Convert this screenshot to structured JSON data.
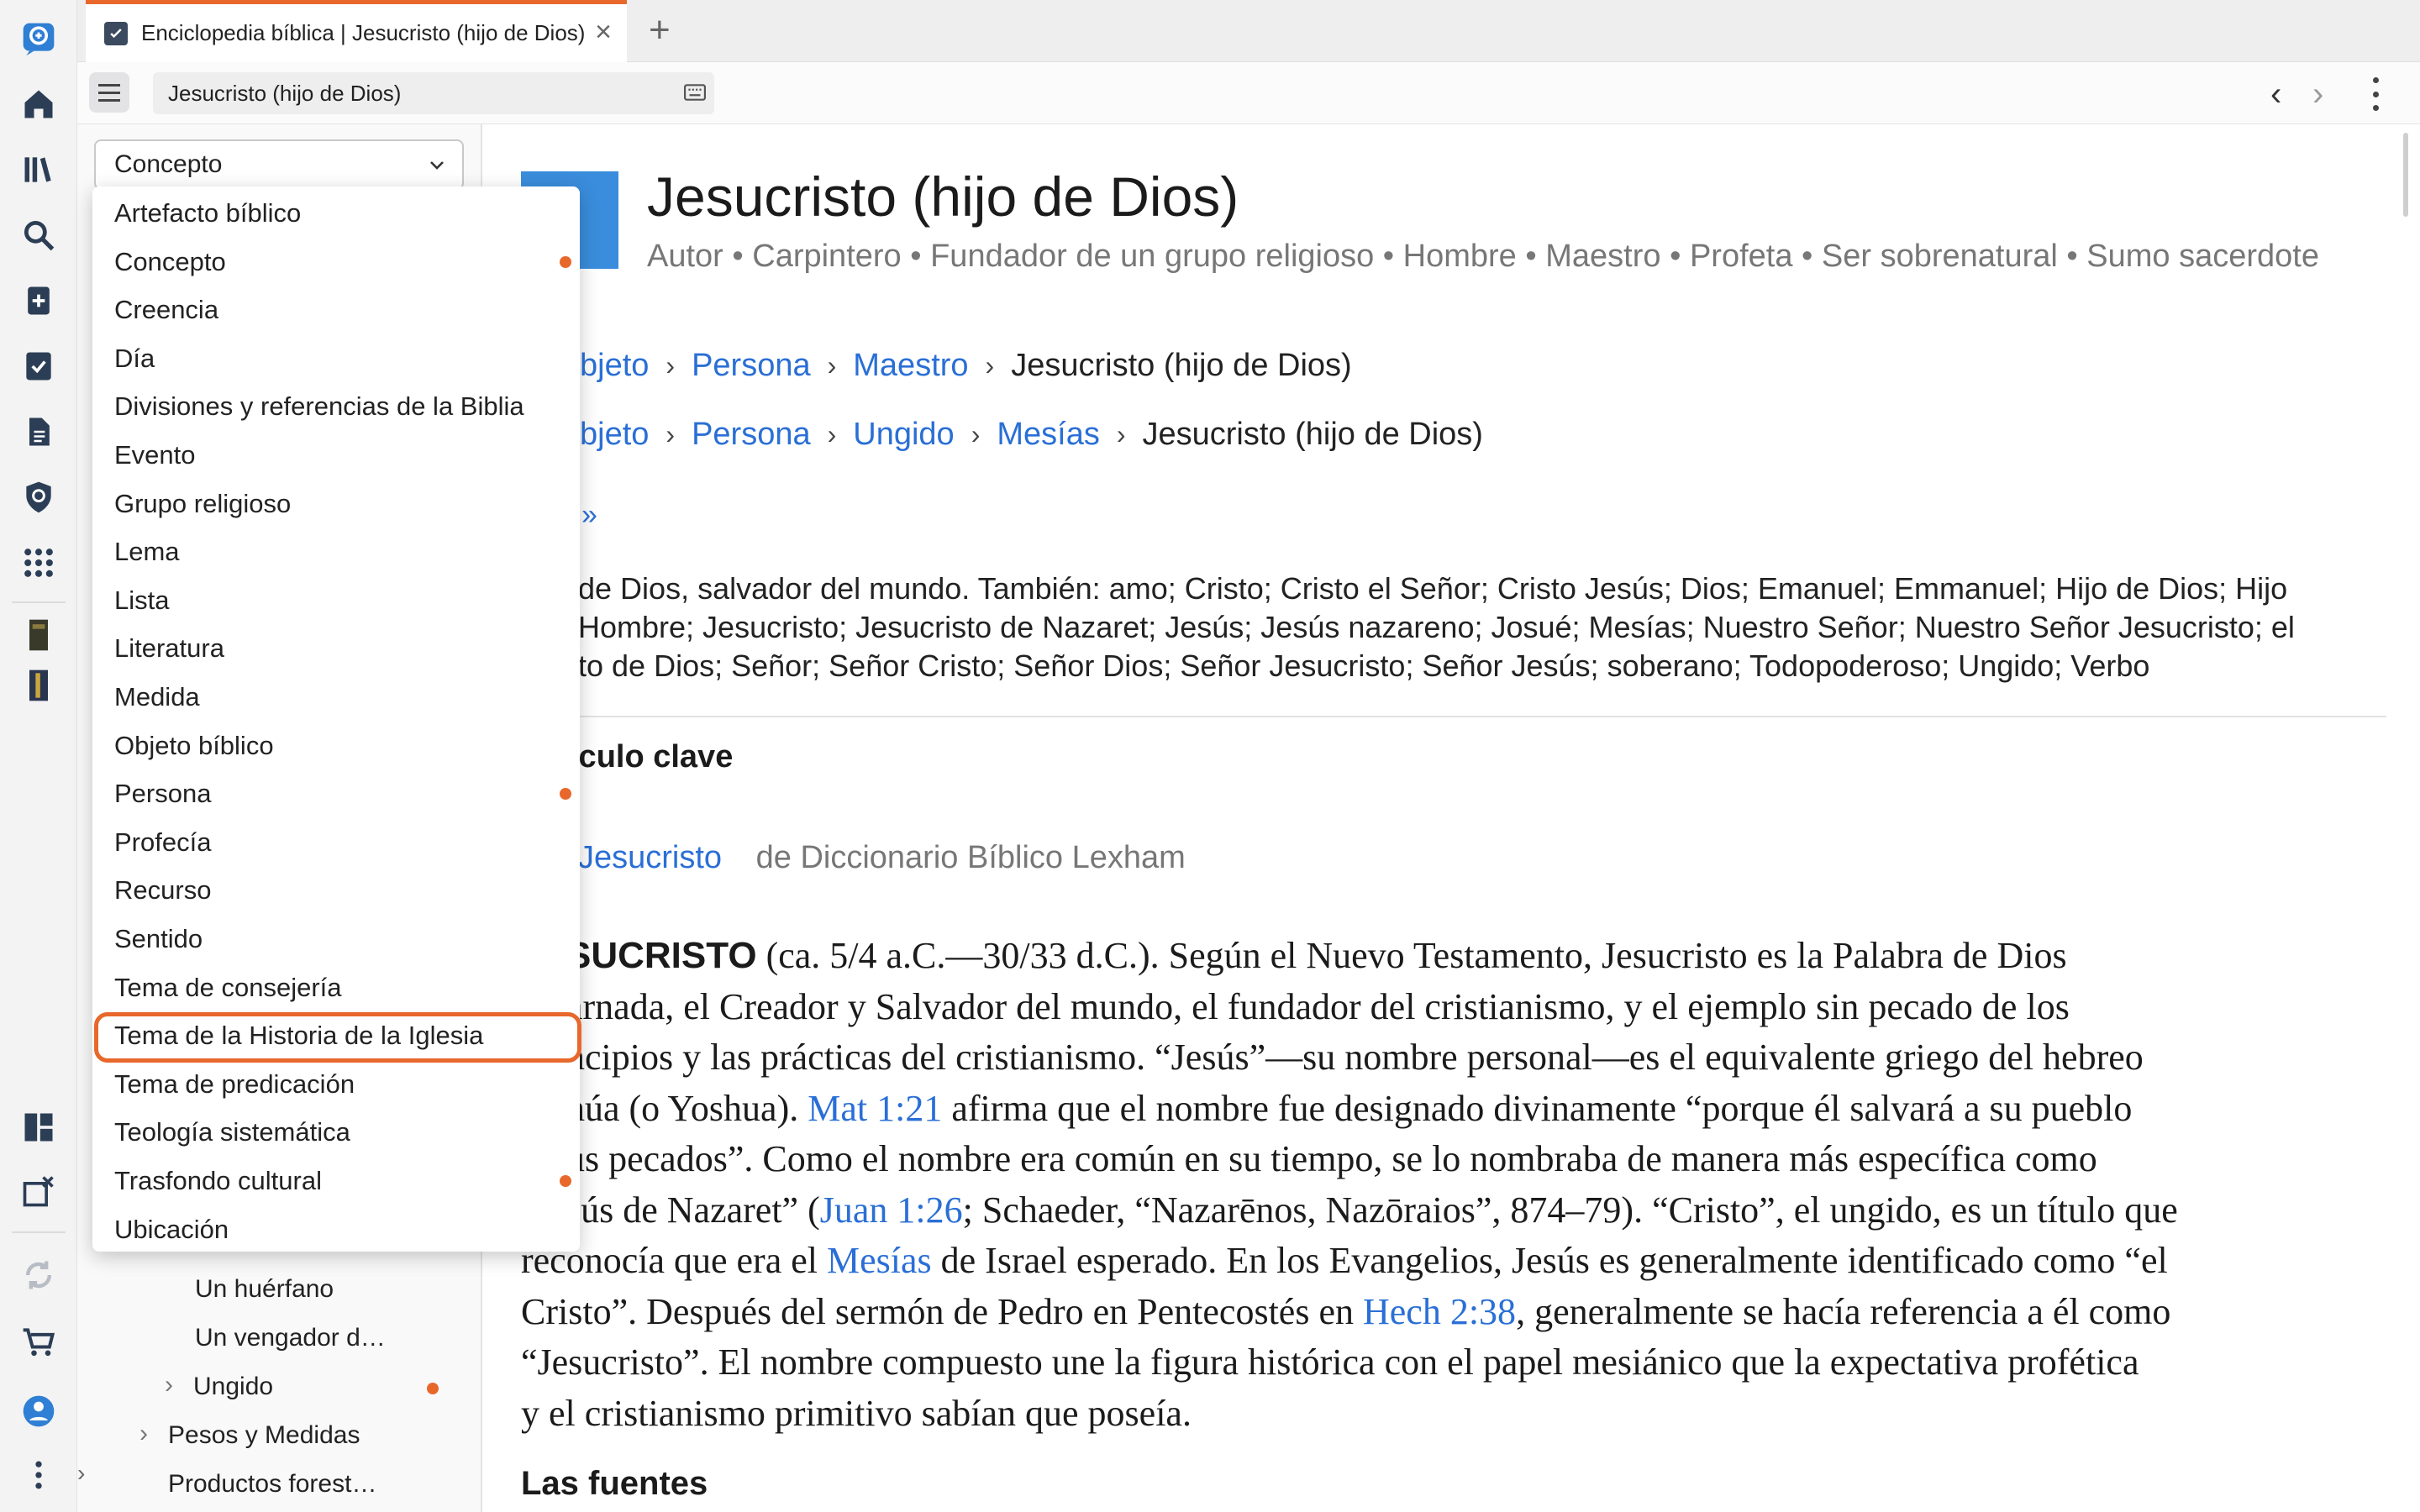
{
  "tab": {
    "title": "Enciclopedia bíblica | Jesucristo (hijo de Dios)"
  },
  "toolbar": {
    "address": "Jesucristo (hijo de Dios)"
  },
  "left_panel": {
    "select_value": "Concepto",
    "tree": [
      {
        "label": "Un huérfano",
        "has_chevron": false,
        "dot": false
      },
      {
        "label": "Un vengador d…",
        "has_chevron": false,
        "dot": false
      },
      {
        "label": "Ungido",
        "has_chevron": true,
        "dot": true
      },
      {
        "label": "Pesos y Medidas",
        "has_chevron": true,
        "dot": false
      },
      {
        "label": "Productos forest…",
        "has_chevron": false,
        "dot": false
      }
    ]
  },
  "dropdown": {
    "items": [
      {
        "label": "Artefacto bíblico",
        "dot": false
      },
      {
        "label": "Concepto",
        "dot": true
      },
      {
        "label": "Creencia",
        "dot": false
      },
      {
        "label": "Día",
        "dot": false
      },
      {
        "label": "Divisiones y referencias de la Biblia",
        "dot": false
      },
      {
        "label": "Evento",
        "dot": false
      },
      {
        "label": "Grupo religioso",
        "dot": false
      },
      {
        "label": "Lema",
        "dot": false
      },
      {
        "label": "Lista",
        "dot": false
      },
      {
        "label": "Literatura",
        "dot": false
      },
      {
        "label": "Medida",
        "dot": false
      },
      {
        "label": "Objeto bíblico",
        "dot": false
      },
      {
        "label": "Persona",
        "dot": true
      },
      {
        "label": "Profecía",
        "dot": false
      },
      {
        "label": "Recurso",
        "dot": false
      },
      {
        "label": "Sentido",
        "dot": false
      },
      {
        "label": "Tema de consejería",
        "dot": false
      },
      {
        "label": "Tema de la Historia de la Iglesia",
        "dot": false
      },
      {
        "label": "Tema de predicación",
        "dot": false
      },
      {
        "label": "Teología sistemática",
        "dot": false
      },
      {
        "label": "Trasfondo cultural",
        "dot": true
      },
      {
        "label": "Ubicación",
        "dot": false
      }
    ],
    "highlighted": "Tema de la Historia de la Iglesia"
  },
  "article": {
    "title": "Jesucristo (hijo de Dios)",
    "roles": [
      "Autor",
      "Carpintero",
      "Fundador de un grupo religioso",
      "Hombre",
      "Maestro",
      "Profeta",
      "Ser sobrenatural",
      "Sumo sacerdote"
    ],
    "breadcrumbs": [
      {
        "links": [
          "bjeto",
          "Persona",
          "Maestro"
        ],
        "current": "Jesucristo (hijo de Dios)"
      },
      {
        "links": [
          "bjeto",
          "Persona",
          "Ungido",
          "Mesías"
        ],
        "current": "Jesucristo (hijo de Dios)"
      }
    ],
    "more_link": "»",
    "aliases_lines": [
      "de Dios, salvador del mundo. También: amo; Cristo; Cristo el Señor; Cristo Jesús; Dios; Emanuel; Emmanuel; Hijo de Dios; Hijo",
      "Hombre; Jesucristo; Jesucristo de Nazaret; Jesús; Jesús nazareno; Josué; Mesías; Nuestro Señor; Nuestro Señor Jesucristo; el",
      "to de Dios; Señor; Señor Cristo; Señor Dios; Señor Jesucristo; Señor Jesús; soberano; Todopoderoso; Ungido; Verbo"
    ],
    "key_verse_heading": "ículo clave",
    "source_link": "Jesucristo",
    "source_name": "de Diccionario Bíblico Lexham",
    "body": {
      "lead": "SUCRISTO",
      "p1": " (ca. 5/4 a.C.—30/33 d.C.). Según el Nuevo Testamento, Jesucristo es la Palabra de Dios",
      "l2": "arnada, el Creador y Salvador del mundo, el fundador del cristianismo, y el ejemplo sin pecado de los",
      "l3": "ncipios y las prácticas del cristianismo. “Jesús”—su nombre personal—es el equivalente griego del hebreo",
      "l4a": "húa (o Yoshua). ",
      "ref1": "Mat 1:21",
      "l4b": " afirma que el nombre fue designado divinamente “porque él salvará a su pueblo",
      "l5": "us pecados”. Como el nombre era común en su tiempo, se lo nombraba de manera más específica como",
      "l6a": "sús de Nazaret” (",
      "ref2": "Juan 1:26",
      "l6b": "; Schaeder, “Nazarēnos, Nazōraios”, 874–79). “Cristo”, el ungido, es un título que",
      "l7a": "reconocía que era el ",
      "ref3": "Mesías",
      "l7b": " de Israel esperado. En los Evangelios, Jesús es generalmente identificado como “el",
      "l8a": "Cristo”. Después del sermón de Pedro en Pentecostés en ",
      "ref4": "Hech 2:38",
      "l8b": ", generalmente se hacía referencia a él como",
      "l9": "“Jesucristo”. El nombre compuesto une la figura histórica con el papel mesiánico que la expectativa profética",
      "l10": "y el cristianismo primitivo sabían que poseía."
    },
    "section_heading": "Las fuentes"
  },
  "colors": {
    "accent": "#e8682c",
    "link": "#2a6fd6",
    "tile": "#3a8ddc"
  }
}
